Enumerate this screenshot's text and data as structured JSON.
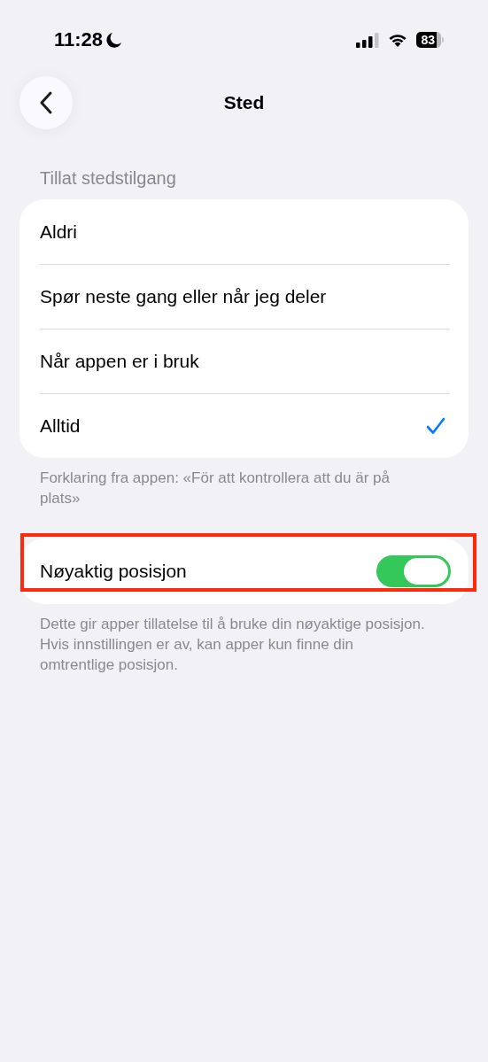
{
  "status_bar": {
    "time": "11:28",
    "focus_moon": true,
    "battery": "83"
  },
  "nav": {
    "title": "Sted"
  },
  "access": {
    "header": "Tillat stedstilgang",
    "options": [
      {
        "label": "Aldri",
        "selected": false
      },
      {
        "label": "Spør neste gang eller når jeg deler",
        "selected": false
      },
      {
        "label": "Når appen er i bruk",
        "selected": false
      },
      {
        "label": "Alltid",
        "selected": true
      }
    ],
    "footer": "Forklaring fra appen: «För att kontrollera att du är på plats»"
  },
  "precise": {
    "label": "Nøyaktig posisjon",
    "on": true,
    "highlighted": true,
    "footer": "Dette gir apper tillatelse til å bruke din nøyaktige posisjon. Hvis innstillingen er av, kan apper kun finne din omtrentlige posisjon."
  }
}
